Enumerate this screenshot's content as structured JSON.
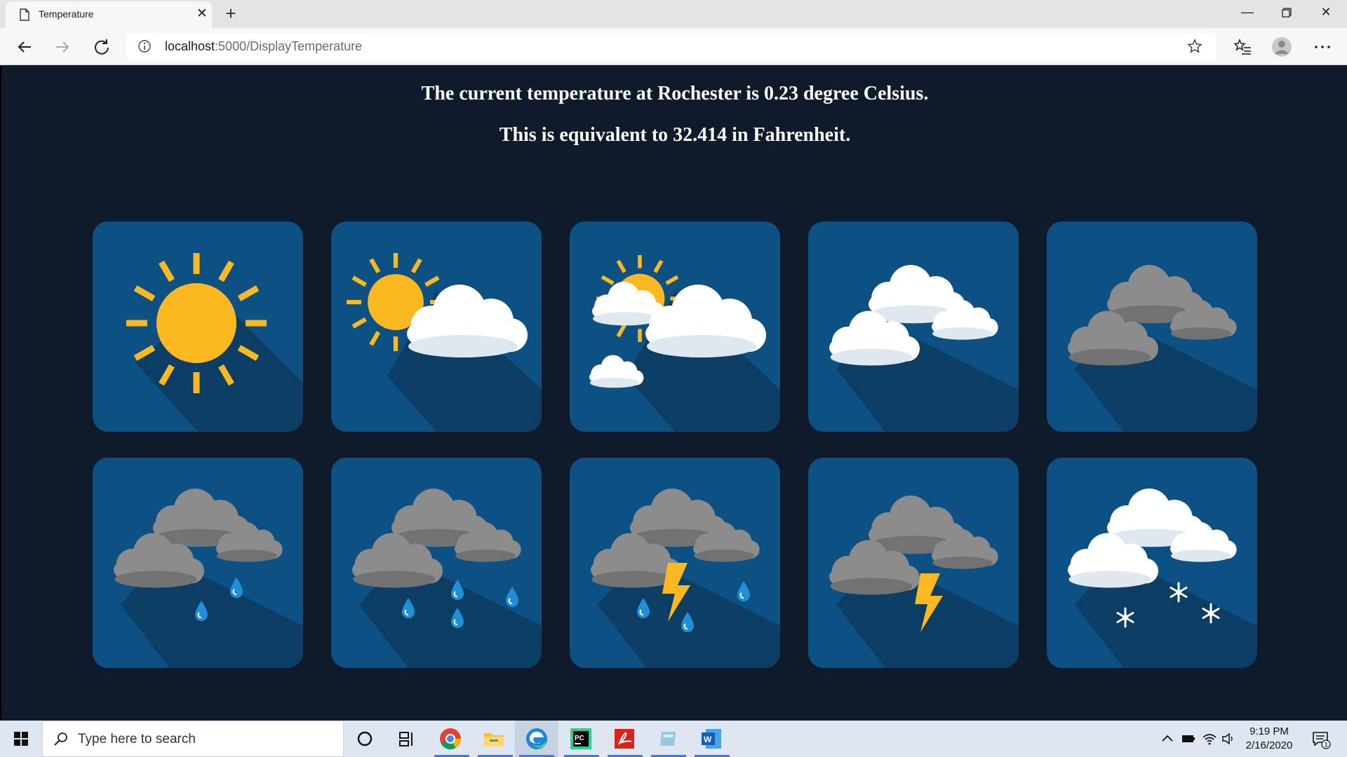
{
  "browser": {
    "tab_title": "Temperature",
    "url_host": "localhost",
    "url_path": ":5000/DisplayTemperature"
  },
  "content": {
    "line1": "The current temperature at Rochester is 0.23 degree Celsius.",
    "line2": "This is equivalent to 32.414 in Fahrenheit."
  },
  "weather_icons": [
    "sunny-icon",
    "partly-sunny-icon",
    "mostly-cloudy-sun-icon",
    "cloudy-icon",
    "overcast-icon",
    "light-rain-icon",
    "rain-icon",
    "thunder-rain-icon",
    "thunderstorm-icon",
    "snow-icon"
  ],
  "colors": {
    "page_bg": "#0f1a2b",
    "tile_bg": "#0d5184",
    "tile_shadow": "#0b3d65",
    "sun": "#fbb820",
    "cloud_white": "#ffffff",
    "cloud_gray": "#8c8c8c",
    "rain": "#1f8fd6",
    "bolt": "#fbb820"
  },
  "taskbar": {
    "search_placeholder": "Type here to search",
    "time": "9:19 PM",
    "date": "2/16/2020",
    "notification_count": "1"
  }
}
